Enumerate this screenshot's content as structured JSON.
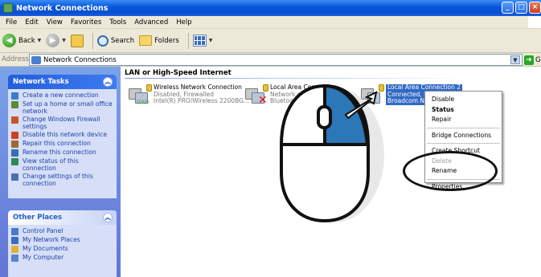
{
  "window": {
    "title": "Network Connections",
    "controls": [
      "_",
      "□",
      "×"
    ]
  },
  "menu": [
    "File",
    "Edit",
    "View",
    "Favorites",
    "Tools",
    "Advanced",
    "Help"
  ],
  "toolbar": {
    "back_label": "Back",
    "search_label": "Search",
    "folders_label": "Folders"
  },
  "address": {
    "label": "Address",
    "value": "Network Connections",
    "go_label": "G"
  },
  "network_tasks": {
    "title": "Network Tasks",
    "items": [
      {
        "label": "Create a new connection",
        "icon": "new-connection-icon",
        "color": "#3b7bd1"
      },
      {
        "label": "Set up a home or small office network",
        "icon": "home-network-icon",
        "color": "#5a8a3a"
      },
      {
        "label": "Change Windows Firewall settings",
        "icon": "firewall-icon",
        "color": "#c8552a"
      },
      {
        "label": "Disable this network device",
        "icon": "disable-icon",
        "color": "#d04020"
      },
      {
        "label": "Repair this connection",
        "icon": "repair-icon",
        "color": "#a06b2a"
      },
      {
        "label": "Rename this connection",
        "icon": "rename-icon",
        "color": "#3a6bb8"
      },
      {
        "label": "View status of this connection",
        "icon": "status-icon",
        "color": "#2a8a5a"
      },
      {
        "label": "Change settings of this connection",
        "icon": "settings-icon",
        "color": "#4a6fb0"
      }
    ]
  },
  "other_places": {
    "title": "Other Places",
    "items": [
      {
        "label": "Control Panel",
        "icon": "control-panel-icon",
        "color": "#4a79c8"
      },
      {
        "label": "My Network Places",
        "icon": "network-places-icon",
        "color": "#3b6bc0"
      },
      {
        "label": "My Documents",
        "icon": "my-documents-icon",
        "color": "#e0b13a"
      },
      {
        "label": "My Computer",
        "icon": "my-computer-icon",
        "color": "#5a84c8"
      }
    ]
  },
  "content": {
    "group_title": "LAN or High-Speed Internet",
    "connections": [
      {
        "name": "Wireless Network Connection",
        "line2": "Disabled, Firewalled",
        "line3": "Intel(R) PRO/Wireless 2200BG..."
      },
      {
        "name": "Local Area Con",
        "line2": "Network c",
        "line3": "Bluetoo"
      },
      {
        "name": "Local Area Connection 2",
        "line2": "Connected, F",
        "line3": "Broadcom Net"
      }
    ]
  },
  "context_menu": {
    "items": [
      "Disable",
      "Status",
      "Repair",
      "Bridge Connections",
      "Create Shortcut",
      "Delete",
      "Rename",
      "Properties"
    ]
  },
  "colors": {
    "title_bar": "#0a4fd0",
    "task_pane": "#6375d6",
    "selection": "#316ac5",
    "mouse_button": "#2b77b8"
  }
}
